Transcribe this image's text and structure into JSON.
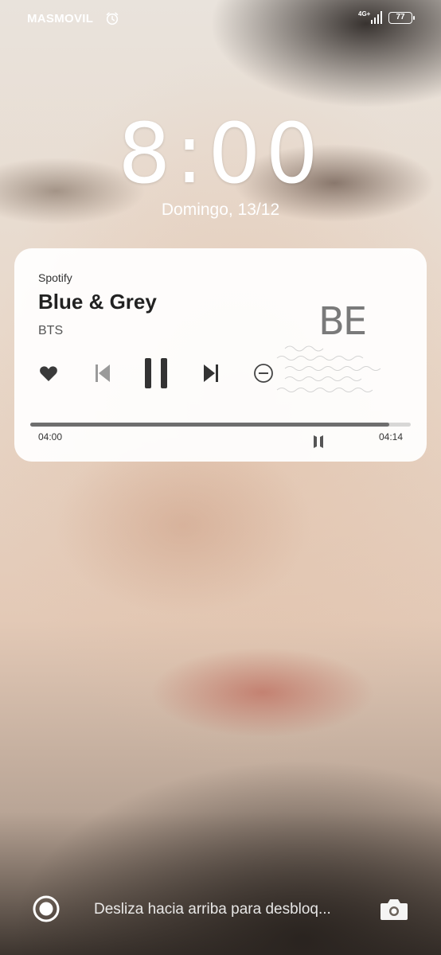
{
  "status_bar": {
    "carrier": "MASMOVIL",
    "network_type": "4G+",
    "battery_level": "77",
    "icons": [
      "alarm-icon",
      "signal-icon",
      "battery-icon"
    ]
  },
  "lockscreen": {
    "time": "8:00",
    "date": "Domingo, 13/12",
    "unlock_hint": "Desliza hacia arriba para desbloq...",
    "icons": [
      "assistant-icon",
      "camera-icon"
    ]
  },
  "media_card": {
    "app": "Spotify",
    "title": "Blue & Grey",
    "artist": "BTS",
    "album_art_text": "BE",
    "elapsed": "04:00",
    "duration": "04:14",
    "progress_fraction": 0.944,
    "controls": [
      "heart-icon",
      "previous-icon",
      "pause-icon",
      "next-icon",
      "remove-icon"
    ]
  },
  "colors": {
    "card_bg": "#ffffff",
    "text_primary": "#222222",
    "control_color": "#333333"
  }
}
